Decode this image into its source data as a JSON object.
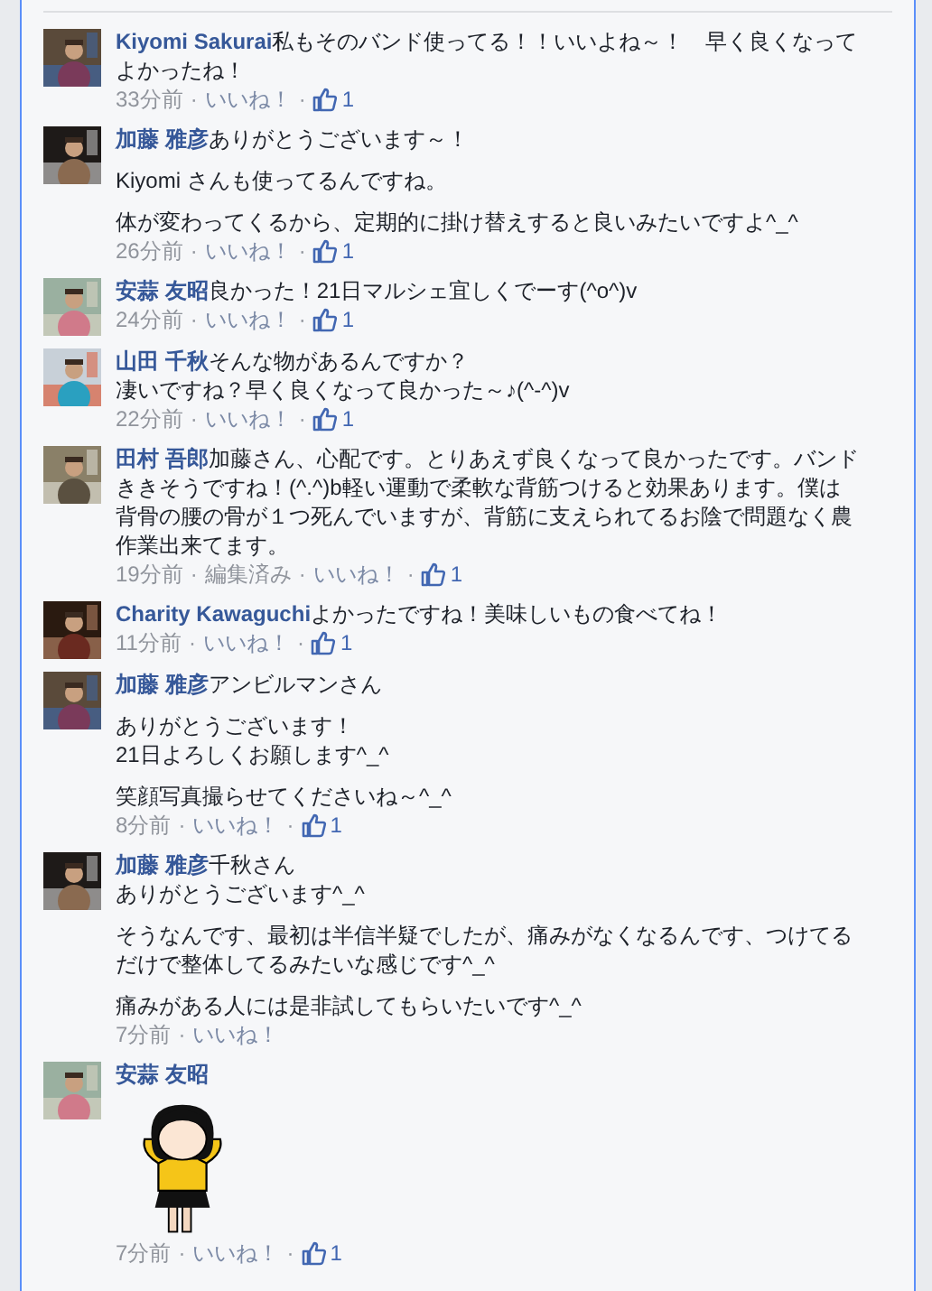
{
  "meta_separator": "·",
  "comments": [
    {
      "author": "Kiyomi Sakurai",
      "avatar": {
        "kind": "picture"
      },
      "paragraphs": [
        [
          "私もそのバンド使ってる！！いいよね～！　早く良くなってよかったね！"
        ]
      ],
      "meta": [
        {
          "kind": "time",
          "text": "33分前"
        },
        {
          "kind": "link",
          "text": "いいね！"
        },
        {
          "kind": "likes",
          "text": "1"
        }
      ]
    },
    {
      "author": "加藤 雅彦",
      "avatar": {
        "kind": "picture"
      },
      "paragraphs": [
        [
          "ありがとうございます～！"
        ],
        [
          "Kiyomi さんも使ってるんですね。"
        ],
        [
          "体が変わってくるから、定期的に掛け替えすると良いみたいですよ^_^"
        ]
      ],
      "meta": [
        {
          "kind": "time",
          "text": "26分前"
        },
        {
          "kind": "link",
          "text": "いいね！"
        },
        {
          "kind": "likes",
          "text": "1"
        }
      ]
    },
    {
      "author": "安蒜 友昭",
      "avatar": {
        "kind": "picture"
      },
      "paragraphs": [
        [
          "良かった！21日マルシェ宜しくでーす(^o^)v"
        ]
      ],
      "meta": [
        {
          "kind": "time",
          "text": "24分前"
        },
        {
          "kind": "link",
          "text": "いいね！"
        },
        {
          "kind": "likes",
          "text": "1"
        }
      ]
    },
    {
      "author": "山田 千秋",
      "avatar": {
        "kind": "picture"
      },
      "paragraphs": [
        [
          "そんな物があるんですか？",
          "凄いですね？早く良くなって良かった～♪(^-^)v"
        ]
      ],
      "meta": [
        {
          "kind": "time",
          "text": "22分前"
        },
        {
          "kind": "link",
          "text": "いいね！"
        },
        {
          "kind": "likes",
          "text": "1"
        }
      ]
    },
    {
      "author": "田村 吾郎",
      "avatar": {
        "kind": "picture"
      },
      "paragraphs": [
        [
          "加藤さん、心配です。とりあえず良くなって良かったです。バンドききそうですね！(^.^)b軽い運動で柔軟な背筋つけると効果あります。僕は背骨の腰の骨が１つ死んでいますが、背筋に支えられてるお陰で問題なく農作業出来てます。"
        ]
      ],
      "meta": [
        {
          "kind": "time",
          "text": "19分前"
        },
        {
          "kind": "edited",
          "text": "編集済み"
        },
        {
          "kind": "link",
          "text": "いいね！"
        },
        {
          "kind": "likes",
          "text": "1"
        }
      ]
    },
    {
      "author": "Charity Kawaguchi",
      "avatar": {
        "kind": "picture"
      },
      "paragraphs": [
        [
          "よかったですね！美味しいもの食べてね！"
        ]
      ],
      "meta": [
        {
          "kind": "time",
          "text": "11分前"
        },
        {
          "kind": "link",
          "text": "いいね！"
        },
        {
          "kind": "likes",
          "text": "1"
        }
      ]
    },
    {
      "author": "加藤 雅彦",
      "avatar": {
        "kind": "picture"
      },
      "paragraphs": [
        [
          "アンビルマンさん"
        ],
        [
          "ありがとうございます！",
          "21日よろしくお願します^_^"
        ],
        [
          "笑顔写真撮らせてくださいね～^_^"
        ]
      ],
      "meta": [
        {
          "kind": "time",
          "text": "8分前"
        },
        {
          "kind": "link",
          "text": "いいね！"
        },
        {
          "kind": "likes",
          "text": "1"
        }
      ]
    },
    {
      "author": "加藤 雅彦",
      "avatar": {
        "kind": "picture"
      },
      "paragraphs": [
        [
          "千秋さん",
          "ありがとうございます^_^"
        ],
        [
          "そうなんです、最初は半信半疑でしたが、痛みがなくなるんです、つけてるだけで整体してるみたいな感じです^_^"
        ],
        [
          "痛みがある人には是非試してもらいたいです^_^"
        ]
      ],
      "meta": [
        {
          "kind": "time",
          "text": "7分前"
        },
        {
          "kind": "link",
          "text": "いいね！"
        }
      ]
    },
    {
      "author": "安蒜 友昭",
      "avatar": {
        "kind": "picture"
      },
      "attachment": {
        "kind": "sticker"
      },
      "meta": [
        {
          "kind": "time",
          "text": "7分前"
        },
        {
          "kind": "link",
          "text": "いいね！"
        },
        {
          "kind": "likes",
          "text": "1"
        }
      ]
    }
  ]
}
